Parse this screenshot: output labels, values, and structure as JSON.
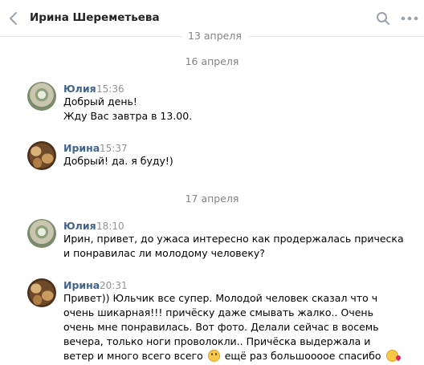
{
  "header": {
    "title": "Ирина Шереметьева"
  },
  "dates": {
    "d1": "13 апреля",
    "d2": "16 апреля",
    "d3": "17 апреля"
  },
  "messages": [
    {
      "author": "Юлия",
      "time": "15:36",
      "lines": [
        "Добрый день!",
        "Жду Вас завтра в 13.00."
      ]
    },
    {
      "author": "Ирина",
      "time": "15:37",
      "lines": [
        "Добрый! да. я буду!)"
      ]
    },
    {
      "author": "Юлия",
      "time": "18:10",
      "lines": [
        "Ирин, привет, до ужаса интересно как продержалась прическа",
        "и понравилас ли молодому человеку?"
      ]
    },
    {
      "author": "Ирина",
      "time": "20:31",
      "lines": [
        "Привет)) Юльчик все супер. Молодой человек сказал что ч",
        "очень шикарная!!! причёску даже смывать жалко.. Очень",
        "очень мне понравилась. Вот фото. Делали сейчас в восемь",
        "вечера, только ноги проволокли.. Причёска выдержала и",
        "ветер и много всего всего",
        "ещё раз большоооое спасибо"
      ]
    }
  ],
  "icons": {
    "back": "chevron-left-icon",
    "search": "search-icon",
    "more": "more-horizontal-icon",
    "emoji1": "smiling-face-emoji",
    "emoji2": "face-blowing-kiss-emoji"
  },
  "colors": {
    "author_link": "#42648b",
    "date_text": "#828282",
    "divider": "#e7e8ec"
  }
}
